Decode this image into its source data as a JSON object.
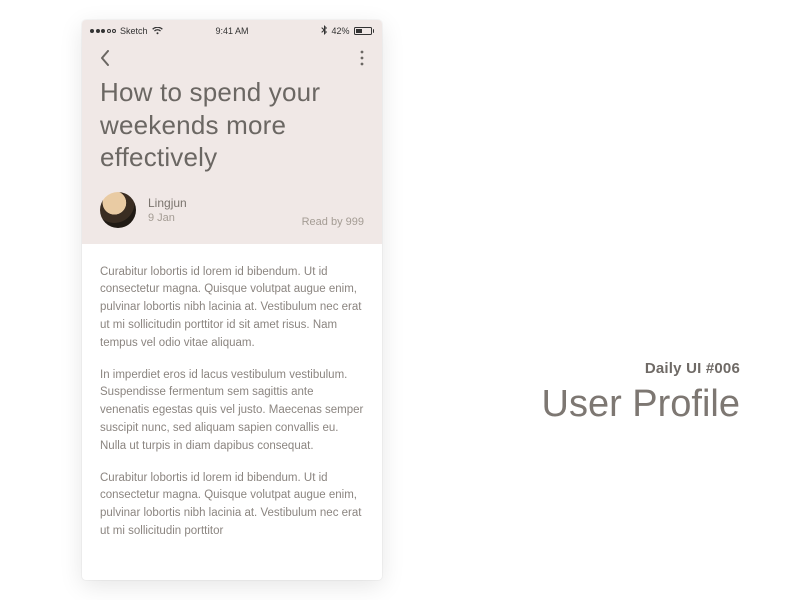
{
  "status": {
    "carrier": "Sketch",
    "time": "9:41 AM",
    "battery_pct": "42%"
  },
  "article": {
    "title": "How to spend your weekends more effectively",
    "author": "Lingjun",
    "date": "9 Jan",
    "read_by": "Read by 999",
    "paragraphs": [
      "Curabitur lobortis id lorem id bibendum. Ut id consectetur magna. Quisque volutpat augue enim, pulvinar lobortis nibh lacinia at. Vestibulum nec erat ut mi sollicitudin porttitor id sit amet risus. Nam tempus vel odio vitae aliquam.",
      "In imperdiet eros id lacus vestibulum vestibulum. Suspendisse fermentum sem sagittis ante venenatis egestas quis vel justo. Maecenas semper suscipit nunc, sed aliquam sapien convallis eu. Nulla ut turpis in diam dapibus consequat.",
      "Curabitur lobortis id lorem id bibendum. Ut id consectetur magna. Quisque volutpat augue enim, pulvinar lobortis nibh lacinia at. Vestibulum nec erat ut mi sollicitudin porttitor"
    ]
  },
  "labels": {
    "kicker": "Daily UI #006",
    "title": "User Profile"
  }
}
